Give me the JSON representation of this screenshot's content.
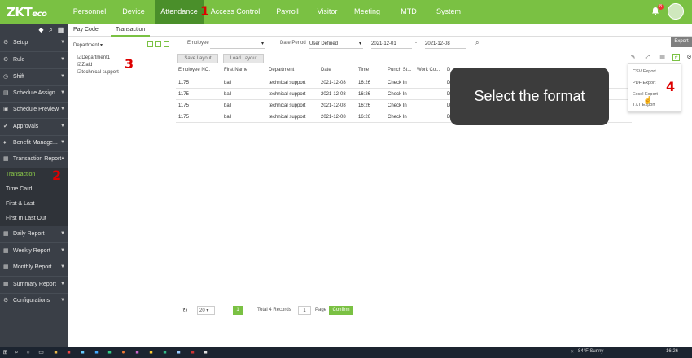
{
  "app": {
    "logo_main": "ZKT",
    "logo_sub": "eco"
  },
  "nav": {
    "tabs": [
      {
        "label": "Personnel"
      },
      {
        "label": "Device"
      },
      {
        "label": "Attendance"
      },
      {
        "label": "Access Control"
      },
      {
        "label": "Payroll"
      },
      {
        "label": "Visitor"
      },
      {
        "label": "Meeting"
      },
      {
        "label": "MTD"
      },
      {
        "label": "System"
      }
    ],
    "notification_count": "8"
  },
  "annotations": {
    "step1": "1",
    "step2": "2",
    "step3": "3",
    "step4": "4"
  },
  "sidebar": {
    "items": [
      {
        "label": "Setup",
        "icon": "gear-icon"
      },
      {
        "label": "Rule",
        "icon": "rule-icon"
      },
      {
        "label": "Shift",
        "icon": "shift-icon"
      },
      {
        "label": "Schedule Assign...",
        "icon": "calendar-icon"
      },
      {
        "label": "Schedule Preview",
        "icon": "preview-icon"
      },
      {
        "label": "Approvals",
        "icon": "approval-icon"
      },
      {
        "label": "Benefit Manage...",
        "icon": "benefit-icon"
      },
      {
        "label": "Transaction Report",
        "icon": "report-icon"
      },
      {
        "label": "Daily Report",
        "icon": "report-icon"
      },
      {
        "label": "Weekly Report",
        "icon": "report-icon"
      },
      {
        "label": "Monthly Report",
        "icon": "report-icon"
      },
      {
        "label": "Summary Report",
        "icon": "report-icon"
      },
      {
        "label": "Configurations",
        "icon": "gear-icon"
      }
    ],
    "sub_items": [
      {
        "label": "Transaction"
      },
      {
        "label": "Time Card"
      },
      {
        "label": "First & Last"
      },
      {
        "label": "First In Last Out"
      }
    ]
  },
  "subtabs": [
    {
      "label": "Pay Code"
    },
    {
      "label": "Transaction"
    }
  ],
  "tree": {
    "header": "Department",
    "items": [
      "Department1",
      "Ziaid",
      "technical support"
    ]
  },
  "filters": {
    "employee_label": "Employee",
    "date_period_label": "Date Period",
    "date_period_value": "User Defined",
    "start_date": "2021-12-01",
    "end_date": "2021-12-08",
    "separator": "-"
  },
  "export": {
    "button": "Export",
    "options": [
      "CSV Export",
      "PDF Export",
      "Excel Export",
      "TXT Export"
    ]
  },
  "layout": {
    "save": "Save Layout",
    "load": "Load Layout"
  },
  "grid": {
    "columns": [
      "Employee NO.",
      "First Name",
      "Department",
      "Date",
      "Time",
      "Punch St...",
      "Work Co...",
      "D"
    ],
    "rows": [
      [
        "1175",
        "ball",
        "technical support",
        "2021-12-08",
        "16:26",
        "Check In",
        "",
        "D"
      ],
      [
        "1175",
        "ball",
        "technical support",
        "2021-12-08",
        "16:26",
        "Check In",
        "",
        "D"
      ],
      [
        "1175",
        "ball",
        "technical support",
        "2021-12-08",
        "16:26",
        "Check In",
        "",
        "D"
      ],
      [
        "1175",
        "ball",
        "technical support",
        "2021-12-08",
        "16:26",
        "Check In",
        "",
        "D"
      ]
    ]
  },
  "callout": {
    "text": "Select the format"
  },
  "pager": {
    "page_size": "20",
    "current_page": "1",
    "total": "Total 4 Records",
    "page_input": "1",
    "page_label": "Page",
    "confirm": "Confirm"
  },
  "taskbar": {
    "weather": "84°F Sunny",
    "time": "16:26"
  }
}
